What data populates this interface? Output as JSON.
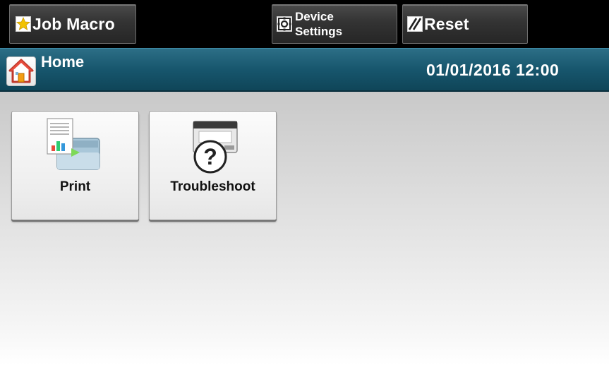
{
  "toolbar": {
    "job_macro_label": "Job Macro",
    "device_settings_line1": "Device",
    "device_settings_line2": "Settings",
    "reset_label": "Reset"
  },
  "header": {
    "title": "Home",
    "datetime": "01/01/2016 12:00"
  },
  "tiles": [
    {
      "label": "Print",
      "icon": "print-icon"
    },
    {
      "label": "Troubleshoot",
      "icon": "troubleshoot-icon"
    }
  ],
  "colors": {
    "topbar_bg": "#000000",
    "header_bg": "#17566d",
    "star_yellow": "#f2c200"
  }
}
